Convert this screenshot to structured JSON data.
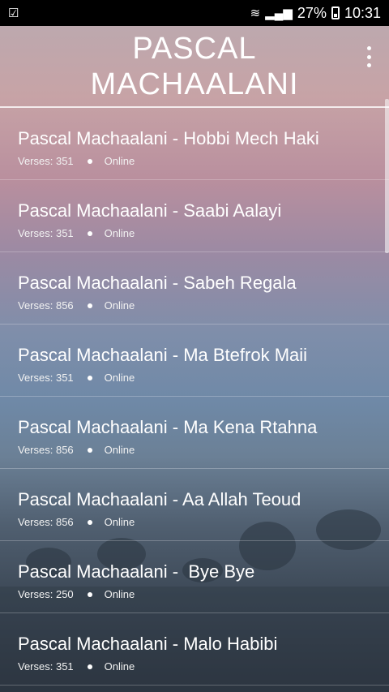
{
  "status_bar": {
    "left_icon": "checkbox-notification-icon",
    "wifi_icon": "wifi-icon",
    "signal_icon": "signal-icon",
    "battery_percent": "27%",
    "time": "10:31"
  },
  "header": {
    "title": "PASCAL MACHAALANI",
    "menu_icon": "overflow-menu-icon"
  },
  "songs": [
    {
      "title": "Pascal Machaalani - Hobbi Mech Haki",
      "verses": "Verses: 351",
      "status": "Online"
    },
    {
      "title": "Pascal Machaalani - Saabi Aalayi",
      "verses": "Verses: 351",
      "status": "Online"
    },
    {
      "title": "Pascal Machaalani - Sabeh Regala",
      "verses": "Verses: 856",
      "status": "Online"
    },
    {
      "title": "Pascal Machaalani - Ma Btefrok Maii",
      "verses": "Verses: 351",
      "status": "Online"
    },
    {
      "title": "Pascal Machaalani - Ma Kena Rtahna",
      "verses": "Verses: 856",
      "status": "Online"
    },
    {
      "title": "Pascal Machaalani - Aa Allah Teoud",
      "verses": "Verses: 856",
      "status": "Online"
    },
    {
      "title": "Pascal Machaalani -  Bye Bye",
      "verses": "Verses: 250",
      "status": "Online"
    },
    {
      "title": "Pascal Machaalani - Malo Habibi",
      "verses": "Verses: 351",
      "status": "Online"
    }
  ]
}
